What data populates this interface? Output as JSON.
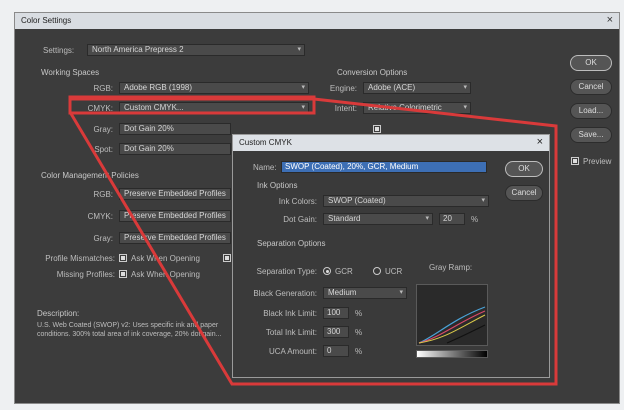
{
  "window": {
    "title": "Color Settings",
    "close": "×"
  },
  "settings": {
    "label": "Settings:",
    "value": "North America Prepress 2"
  },
  "working_spaces": {
    "header": "Working Spaces",
    "rows": [
      {
        "label": "RGB:",
        "value": "Adobe RGB (1998)"
      },
      {
        "label": "CMYK:",
        "value": "Custom CMYK..."
      },
      {
        "label": "Gray:",
        "value": "Dot Gain 20%"
      },
      {
        "label": "Spot:",
        "value": "Dot Gain 20%"
      }
    ]
  },
  "conversion": {
    "header": "Conversion Options",
    "engine_label": "Engine:",
    "engine_value": "Adobe (ACE)",
    "intent_label": "Intent:",
    "intent_value": "Relative Colorimetric"
  },
  "policies": {
    "header": "Color Management Policies",
    "rows": [
      {
        "label": "RGB:",
        "value": "Preserve Embedded Profiles"
      },
      {
        "label": "CMYK:",
        "value": "Preserve Embedded Profiles"
      },
      {
        "label": "Gray:",
        "value": "Preserve Embedded Profiles"
      }
    ],
    "mismatch_label": "Profile Mismatches:",
    "mismatch_check": "Ask When Opening",
    "missing_label": "Missing Profiles:",
    "missing_check": "Ask When Opening"
  },
  "description": {
    "header": "Description:",
    "text": "U.S. Web Coated (SWOP) v2: Uses specific ink and paper conditions. 300% total area of ink coverage, 20% dot gain..."
  },
  "buttons": {
    "ok": "OK",
    "cancel": "Cancel",
    "load": "Load...",
    "save": "Save...",
    "preview": "Preview"
  },
  "custom_cmyk": {
    "title": "Custom CMYK",
    "close": "×",
    "name_label": "Name:",
    "name_value": "SWOP (Coated), 20%, GCR, Medium",
    "ok": "OK",
    "cancel": "Cancel",
    "ink_header": "Ink Options",
    "ink_colors_label": "Ink Colors:",
    "ink_colors_value": "SWOP (Coated)",
    "dot_gain_label": "Dot Gain:",
    "dot_gain_value": "Standard",
    "dot_gain_pct": "20",
    "pct": "%",
    "sep_header": "Separation Options",
    "sep_type_label": "Separation Type:",
    "gcr": "GCR",
    "ucr": "UCR",
    "gray_ramp": "Gray Ramp:",
    "black_gen_label": "Black Generation:",
    "black_gen_value": "Medium",
    "black_ink_label": "Black Ink Limit:",
    "black_ink_value": "100",
    "total_ink_label": "Total Ink Limit:",
    "total_ink_value": "300",
    "uca_label": "UCA Amount:",
    "uca_value": "0"
  },
  "colors": {
    "highlight": "#d93a3a",
    "selection": "#3d6fb5"
  }
}
